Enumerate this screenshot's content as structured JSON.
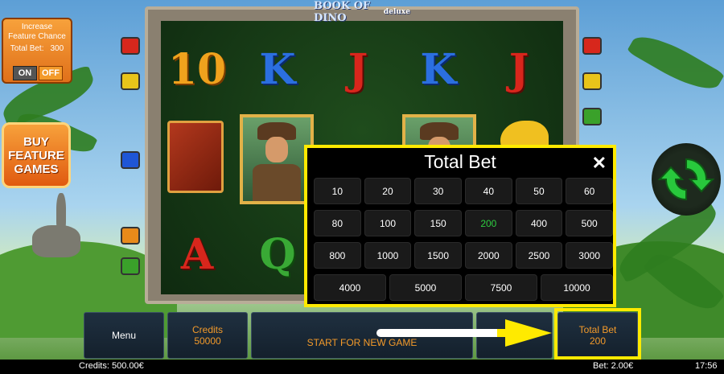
{
  "game": {
    "logo_line1": "BOOK OF DINO",
    "logo_line2": "deluxe"
  },
  "feature": {
    "line1": "Increase",
    "line2": "Feature Chance",
    "total_bet_label": "Total Bet:",
    "total_bet_value": "300",
    "on_label": "ON",
    "off_label": "OFF"
  },
  "buy_feature": {
    "line1": "BUY",
    "line2": "FEATURE",
    "line3": "GAMES"
  },
  "reels": {
    "row1": [
      "10",
      "K",
      "J",
      "K",
      "J"
    ],
    "row3": [
      "A",
      "Q"
    ]
  },
  "bet_dialog": {
    "title": "Total Bet",
    "close": "✕",
    "selected": "200",
    "rows": [
      [
        "10",
        "20",
        "30",
        "40",
        "50",
        "60"
      ],
      [
        "80",
        "100",
        "150",
        "200",
        "400",
        "500"
      ],
      [
        "800",
        "1000",
        "1500",
        "2000",
        "2500",
        "3000"
      ],
      [
        "4000",
        "5000",
        "7500",
        "10000"
      ]
    ]
  },
  "bottom": {
    "menu": "Menu",
    "credits_label": "Credits",
    "credits_value": "50000",
    "message": "START FOR NEW GAME",
    "total_bet_label": "Total Bet",
    "total_bet_value": "200"
  },
  "status": {
    "credits": "Credits: 500.00€",
    "bet": "Bet: 2.00€",
    "time": "17:56"
  },
  "colors": {
    "highlight": "#ffea00",
    "selected_bet": "#2ecc40",
    "accent_orange": "#f39a2a"
  }
}
